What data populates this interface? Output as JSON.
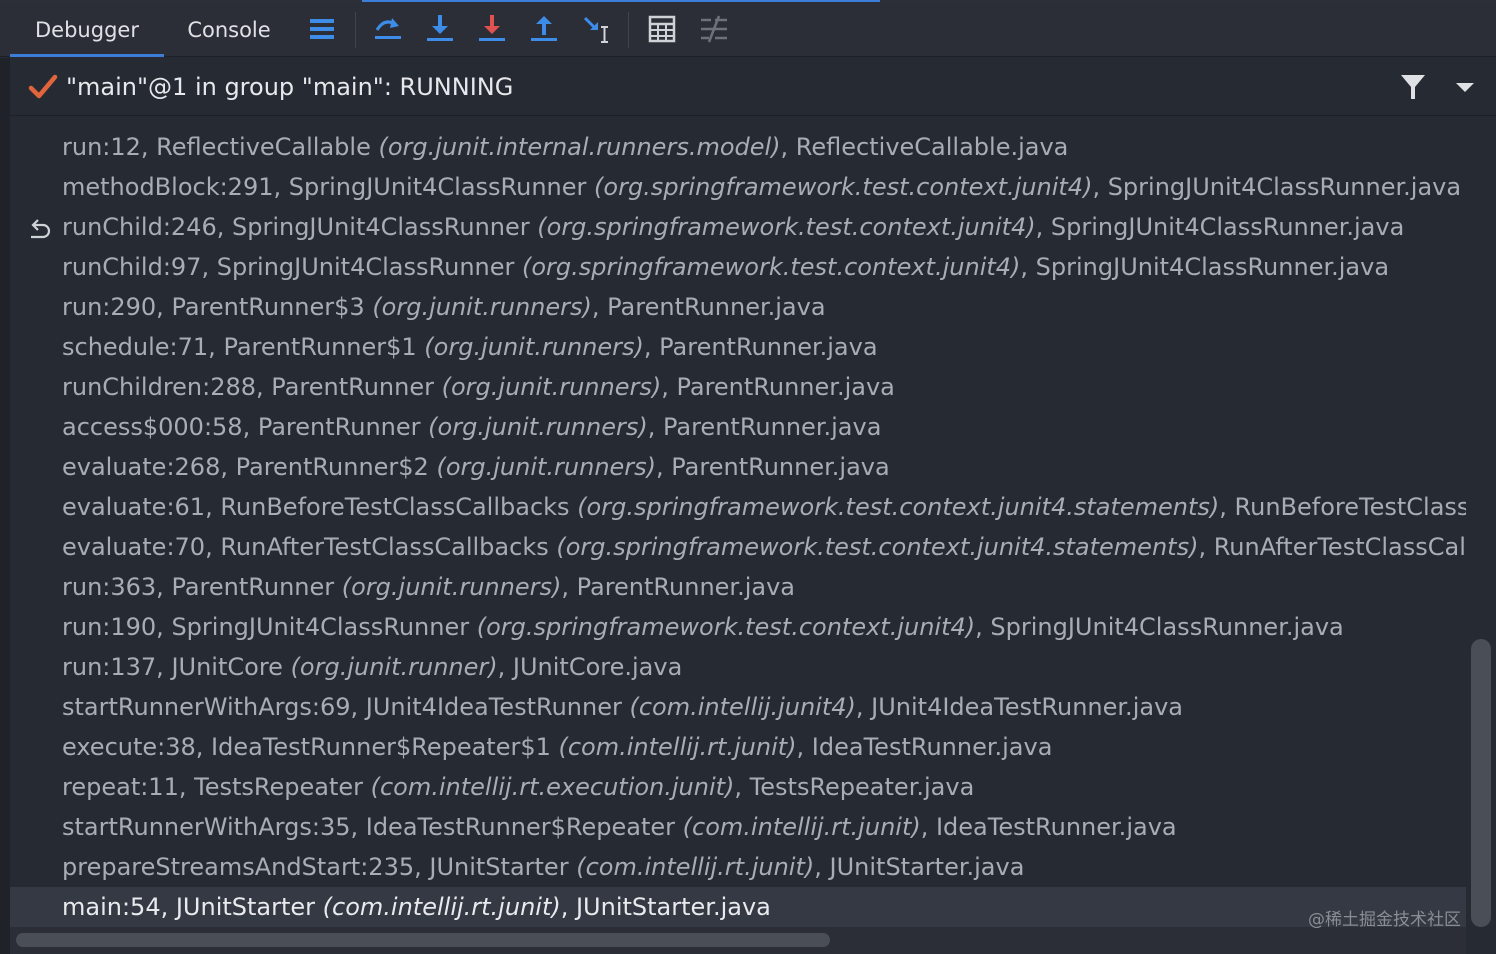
{
  "tabs": [
    {
      "label": "Debugger",
      "active": true
    },
    {
      "label": "Console",
      "active": false
    }
  ],
  "toolbar_icons": [
    "show-execution-point-icon",
    "step-over-icon",
    "step-into-icon",
    "force-step-into-icon",
    "step-out-icon",
    "run-to-cursor-icon",
    "evaluate-expression-icon",
    "trace-current-stream-icon"
  ],
  "thread": {
    "status_icon": "check-icon",
    "title": "\"main\"@1 in group \"main\": RUNNING"
  },
  "frames": [
    {
      "method": "run:12, ReflectiveCallable ",
      "pkg": "(org.junit.internal.runners.model)",
      "file": ", ReflectiveCallable.java"
    },
    {
      "method": "methodBlock:291, SpringJUnit4ClassRunner ",
      "pkg": "(org.springframework.test.context.junit4)",
      "file": ", SpringJUnit4ClassRunner.java"
    },
    {
      "method": "runChild:246, SpringJUnit4ClassRunner ",
      "pkg": "(org.springframework.test.context.junit4)",
      "file": ", SpringJUnit4ClassRunner.java"
    },
    {
      "method": "runChild:97, SpringJUnit4ClassRunner ",
      "pkg": "(org.springframework.test.context.junit4)",
      "file": ", SpringJUnit4ClassRunner.java"
    },
    {
      "method": "run:290, ParentRunner$3 ",
      "pkg": "(org.junit.runners)",
      "file": ", ParentRunner.java"
    },
    {
      "method": "schedule:71, ParentRunner$1 ",
      "pkg": "(org.junit.runners)",
      "file": ", ParentRunner.java"
    },
    {
      "method": "runChildren:288, ParentRunner ",
      "pkg": "(org.junit.runners)",
      "file": ", ParentRunner.java"
    },
    {
      "method": "access$000:58, ParentRunner ",
      "pkg": "(org.junit.runners)",
      "file": ", ParentRunner.java"
    },
    {
      "method": "evaluate:268, ParentRunner$2 ",
      "pkg": "(org.junit.runners)",
      "file": ", ParentRunner.java"
    },
    {
      "method": "evaluate:61, RunBeforeTestClassCallbacks ",
      "pkg": "(org.springframework.test.context.junit4.statements)",
      "file": ", RunBeforeTestClassCallbacks.java"
    },
    {
      "method": "evaluate:70, RunAfterTestClassCallbacks ",
      "pkg": "(org.springframework.test.context.junit4.statements)",
      "file": ", RunAfterTestClassCallbacks.java"
    },
    {
      "method": "run:363, ParentRunner ",
      "pkg": "(org.junit.runners)",
      "file": ", ParentRunner.java"
    },
    {
      "method": "run:190, SpringJUnit4ClassRunner ",
      "pkg": "(org.springframework.test.context.junit4)",
      "file": ", SpringJUnit4ClassRunner.java"
    },
    {
      "method": "run:137, JUnitCore ",
      "pkg": "(org.junit.runner)",
      "file": ", JUnitCore.java"
    },
    {
      "method": "startRunnerWithArgs:69, JUnit4IdeaTestRunner ",
      "pkg": "(com.intellij.junit4)",
      "file": ", JUnit4IdeaTestRunner.java"
    },
    {
      "method": "execute:38, IdeaTestRunner$Repeater$1 ",
      "pkg": "(com.intellij.rt.junit)",
      "file": ", IdeaTestRunner.java"
    },
    {
      "method": "repeat:11, TestsRepeater ",
      "pkg": "(com.intellij.rt.execution.junit)",
      "file": ", TestsRepeater.java"
    },
    {
      "method": "startRunnerWithArgs:35, IdeaTestRunner$Repeater ",
      "pkg": "(com.intellij.rt.junit)",
      "file": ", IdeaTestRunner.java"
    },
    {
      "method": "prepareStreamsAndStart:235, JUnitStarter ",
      "pkg": "(com.intellij.rt.junit)",
      "file": ", JUnitStarter.java"
    },
    {
      "method": "main:54, JUnitStarter ",
      "pkg": "(com.intellij.rt.junit)",
      "file": ", JUnitStarter.java",
      "selected": true
    }
  ],
  "watermark": "@稀土掘金技术社区",
  "colors": {
    "accent": "#3d7dd8",
    "check": "#e0653c",
    "stop_red": "#e05252",
    "background": "#262a33"
  }
}
